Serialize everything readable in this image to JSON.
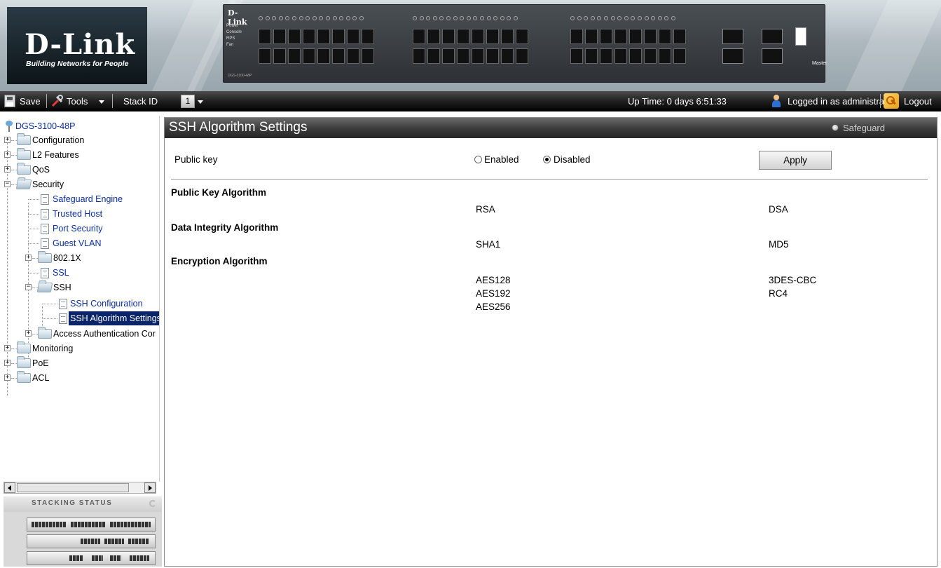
{
  "brand": {
    "logo": "D-Link",
    "tagline": "Building Networks for People",
    "switch_brand": "D-Link",
    "switch_leds": [
      "Power",
      "Console",
      "RPS",
      "Fan"
    ],
    "switch_model": "DGS-3100-48P",
    "switch_master": "Master"
  },
  "toolbar": {
    "save_label": "Save",
    "tools_label": "Tools",
    "stack_id_label": "Stack ID",
    "stack_id_value": "1",
    "uptime": "Up Time: 0 days 6:51:33",
    "logged_in": "Logged in as administrator",
    "logout_label": "Logout"
  },
  "tree": {
    "root": "DGS-3100-48P",
    "items": {
      "configuration": "Configuration",
      "l2_features": "L2 Features",
      "qos": "QoS",
      "security": "Security",
      "safeguard_engine": "Safeguard Engine",
      "trusted_host": "Trusted Host",
      "port_security": "Port Security",
      "guest_vlan": "Guest VLAN",
      "dot1x": "802.1X",
      "ssl": "SSL",
      "ssh": "SSH",
      "ssh_configuration": "SSH Configuration",
      "ssh_algorithm_settings": "SSH Algorithm Settings",
      "access_auth": "Access Authentication Cor",
      "monitoring": "Monitoring",
      "poe": "PoE",
      "acl": "ACL"
    }
  },
  "stacking": {
    "title": "STACKING STATUS"
  },
  "main": {
    "title": "SSH Algorithm Settings",
    "safeguard": "Safeguard",
    "public_key_label": "Public key",
    "public_key_state": "Disabled",
    "enabled_label": "Enabled",
    "disabled_label": "Disabled",
    "apply_label": "Apply",
    "sections": {
      "public_key_algorithm": {
        "heading": "Public Key Algorithm",
        "col1": [
          "RSA"
        ],
        "col2": [
          "DSA"
        ]
      },
      "data_integrity_algorithm": {
        "heading": "Data Integrity Algorithm",
        "col1": [
          "SHA1"
        ],
        "col2": [
          "MD5"
        ]
      },
      "encryption_algorithm": {
        "heading": "Encryption Algorithm",
        "col1": [
          "AES128",
          "AES192",
          "AES256"
        ],
        "col2": [
          "3DES-CBC",
          "RC4"
        ]
      }
    }
  },
  "colors": {
    "link": "#0b2fa0",
    "selected_bg": "#0a246a",
    "header_dark": "#262626"
  }
}
